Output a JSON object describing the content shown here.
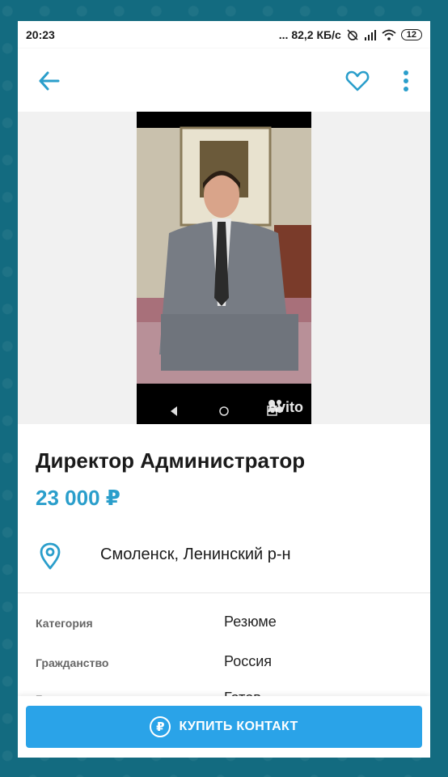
{
  "statusbar": {
    "time": "20:23",
    "network": "... 82,2 КБ/с",
    "battery": "12"
  },
  "photo": {
    "watermark": "Avito"
  },
  "listing": {
    "title": "Директор Администратор",
    "price": "23 000 ₽",
    "location": "Смоленск, Ленинский р-н"
  },
  "params": [
    {
      "label": "Категория",
      "value": "Резюме"
    },
    {
      "label": "Гражданство",
      "value": "Россия"
    },
    {
      "label": "Г",
      "value": "Готов"
    }
  ],
  "buy": {
    "label": "КУПИТЬ КОНТАКТ",
    "icon_glyph": "₽"
  },
  "colors": {
    "accent": "#2a9ecb",
    "button": "#2aa3e8",
    "frame": "#136b80"
  }
}
